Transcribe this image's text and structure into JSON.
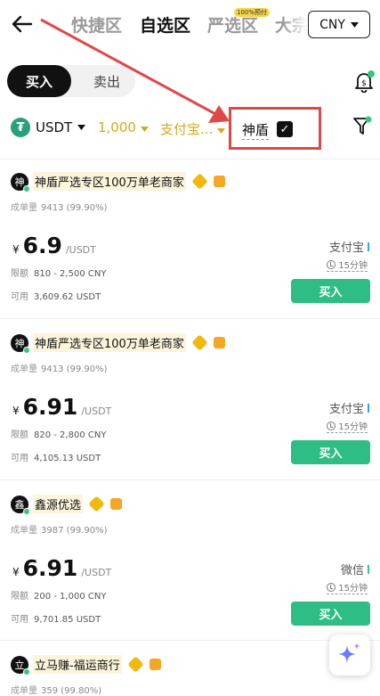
{
  "header": {
    "tabs": [
      {
        "label": "快捷区",
        "active": false
      },
      {
        "label": "自选区",
        "active": true
      },
      {
        "label": "严选区",
        "active": false,
        "badge": "100%预付"
      },
      {
        "label": "大宗",
        "active": false
      }
    ],
    "currency": "CNY"
  },
  "trade_toggle": {
    "buy": "买入",
    "sell": "卖出"
  },
  "filters": {
    "coin": "USDT",
    "amount": "1,000",
    "payment": "支付宝...",
    "shield_label": "神盾",
    "shield_checked": true
  },
  "listings": [
    {
      "avatar": "神",
      "merchant": "神盾严选专区100万单老商家",
      "orders_label": "成单量",
      "orders": "9413 (99.90%)",
      "currency_symbol": "¥",
      "price": "6.9",
      "unit": "/USDT",
      "limit_label": "限额",
      "limit": "810 - 2,500 CNY",
      "available_label": "可用",
      "available": "3,609.62 USDT",
      "method": "支付宝",
      "eta": "15分钟",
      "button": "买入"
    },
    {
      "avatar": "神",
      "merchant": "神盾严选专区100万单老商家",
      "orders_label": "成单量",
      "orders": "9413 (99.90%)",
      "currency_symbol": "¥",
      "price": "6.91",
      "unit": "/USDT",
      "limit_label": "限额",
      "limit": "820 - 2,800 CNY",
      "available_label": "可用",
      "available": "4,105.13 USDT",
      "method": "支付宝",
      "eta": "15分钟",
      "button": "买入"
    },
    {
      "avatar": "鑫",
      "merchant": "鑫源优选",
      "orders_label": "成单量",
      "orders": "3987 (99.90%)",
      "currency_symbol": "¥",
      "price": "6.91",
      "unit": "/USDT",
      "limit_label": "限额",
      "limit": "200 - 1,000 CNY",
      "available_label": "可用",
      "available": "9,701.85 USDT",
      "method": "微信",
      "eta": "15分钟",
      "button": "买入"
    },
    {
      "avatar": "立",
      "merchant": "立马赚-福运商行",
      "orders_label": "成单量",
      "orders": "359 (99.80%)"
    }
  ],
  "icons": {
    "back": "arrow-left-icon",
    "bell": "bell-dollar-icon",
    "filter": "funnel-icon",
    "fab": "sparkle-icon"
  },
  "colors": {
    "accent_gold": "#d9a81b",
    "buy_green": "#2ebd85",
    "highlight_red": "#e04848"
  }
}
